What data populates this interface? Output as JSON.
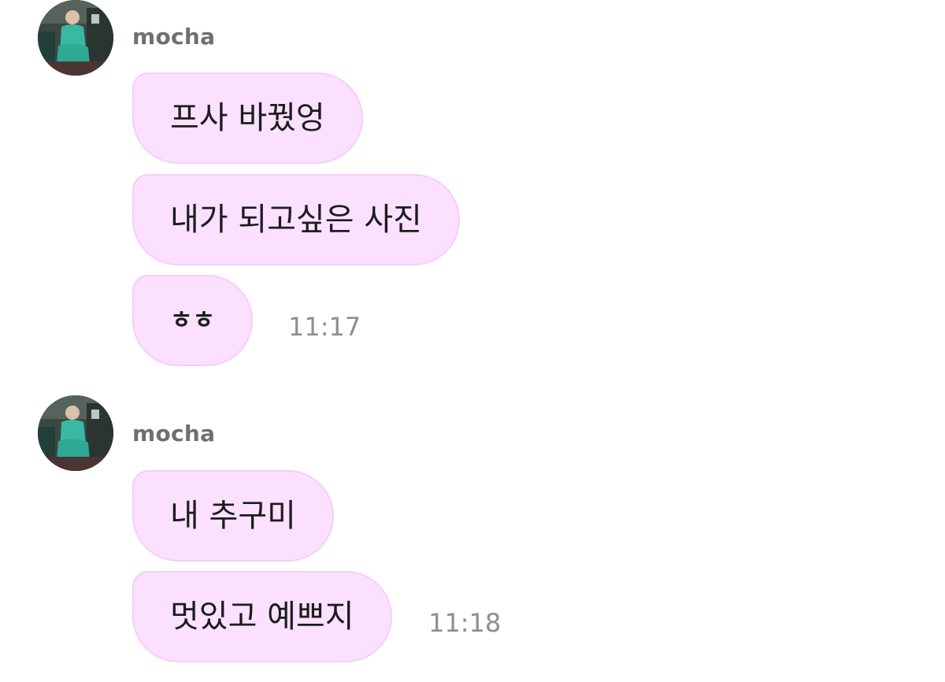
{
  "groups": [
    {
      "sender": "mocha",
      "messages": [
        "프사 바꿨엉",
        "내가 되고싶은 사진",
        "ㅎㅎ"
      ],
      "time": "11:17"
    },
    {
      "sender": "mocha",
      "messages": [
        "내 추구미",
        "멋있고 예쁘지"
      ],
      "time": "11:18"
    }
  ],
  "colors": {
    "bubble_bg": "#fbe1ff",
    "bubble_border": "#f6cdfb",
    "sender_text": "#6f6f6f",
    "time_text": "#8e8e8e"
  },
  "icons": {
    "avatar": "profile-photo"
  }
}
